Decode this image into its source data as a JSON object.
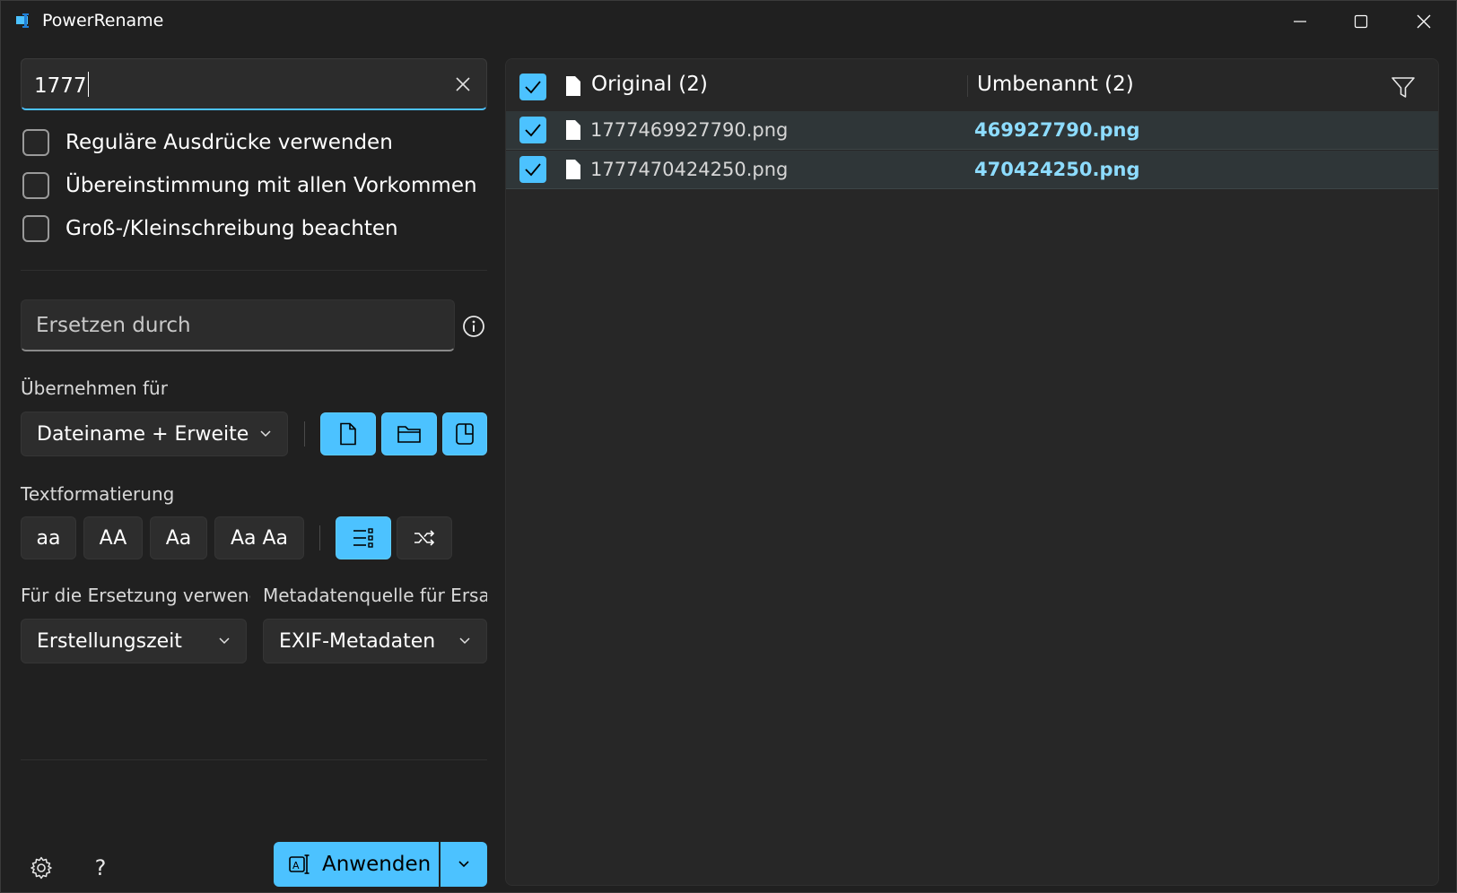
{
  "window": {
    "title": "PowerRename",
    "controls": [
      "minimize",
      "maximize",
      "close"
    ]
  },
  "search": {
    "value": "1777",
    "clear_icon": "close-icon"
  },
  "options": [
    {
      "label": "Reguläre Ausdrücke verwenden",
      "checked": false
    },
    {
      "label": "Übereinstimmung mit allen Vorkommen",
      "checked": false
    },
    {
      "label": "Groß-/Kleinschreibung beachten",
      "checked": false
    }
  ],
  "replace": {
    "placeholder": "Ersetzen durch",
    "info_icon": "info-icon"
  },
  "apply_to": {
    "label": "Übernehmen für",
    "selected": "Dateiname + Erweite",
    "buttons": [
      {
        "icon": "file-icon",
        "active": true
      },
      {
        "icon": "folder-icon",
        "active": true
      },
      {
        "icon": "subfolder-icon",
        "active": true
      }
    ]
  },
  "text_formatting": {
    "label": "Textformatierung",
    "buttons": [
      "aa",
      "AA",
      "Aa",
      "Aa Aa"
    ],
    "enumerate_icon": "enumerate-icon",
    "random_icon": "shuffle-icon"
  },
  "replacement_use": {
    "label": "Für die Ersetzung verwend",
    "selected": "Erstellungszeit"
  },
  "metadata_source": {
    "label": "Metadatenquelle für Ersat:",
    "selected": "EXIF-Metadaten"
  },
  "footer": {
    "settings_icon": "gear-icon",
    "help_label": "?",
    "apply_label": "Anwenden"
  },
  "file_list": {
    "original_header": "Original (2)",
    "renamed_header": "Umbenannt (2)",
    "filter_icon": "filter-icon",
    "rows": [
      {
        "original": "1777469927790.png",
        "renamed": "469927790.png",
        "checked": true
      },
      {
        "original": "1777470424250.png",
        "renamed": "470424250.png",
        "checked": true
      }
    ]
  },
  "colors": {
    "accent": "#4cc2ff",
    "renamed_text": "#8ddcff",
    "background": "#202020",
    "panel": "#272727"
  }
}
